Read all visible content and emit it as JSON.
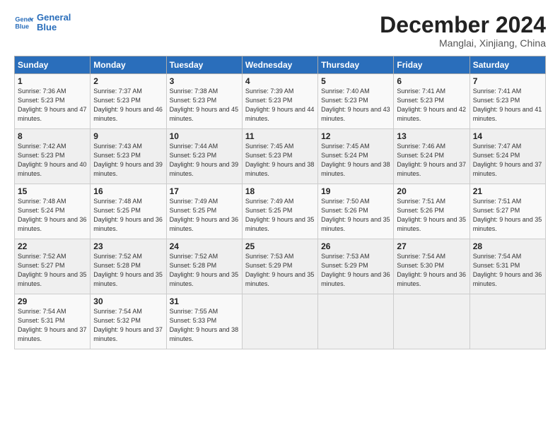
{
  "header": {
    "logo_line1": "General",
    "logo_line2": "Blue",
    "month": "December 2024",
    "location": "Manglai, Xinjiang, China"
  },
  "days_of_week": [
    "Sunday",
    "Monday",
    "Tuesday",
    "Wednesday",
    "Thursday",
    "Friday",
    "Saturday"
  ],
  "weeks": [
    [
      {
        "num": "1",
        "rise": "7:36 AM",
        "set": "5:23 PM",
        "daylight": "9 hours and 47 minutes."
      },
      {
        "num": "2",
        "rise": "7:37 AM",
        "set": "5:23 PM",
        "daylight": "9 hours and 46 minutes."
      },
      {
        "num": "3",
        "rise": "7:38 AM",
        "set": "5:23 PM",
        "daylight": "9 hours and 45 minutes."
      },
      {
        "num": "4",
        "rise": "7:39 AM",
        "set": "5:23 PM",
        "daylight": "9 hours and 44 minutes."
      },
      {
        "num": "5",
        "rise": "7:40 AM",
        "set": "5:23 PM",
        "daylight": "9 hours and 43 minutes."
      },
      {
        "num": "6",
        "rise": "7:41 AM",
        "set": "5:23 PM",
        "daylight": "9 hours and 42 minutes."
      },
      {
        "num": "7",
        "rise": "7:41 AM",
        "set": "5:23 PM",
        "daylight": "9 hours and 41 minutes."
      }
    ],
    [
      {
        "num": "8",
        "rise": "7:42 AM",
        "set": "5:23 PM",
        "daylight": "9 hours and 40 minutes."
      },
      {
        "num": "9",
        "rise": "7:43 AM",
        "set": "5:23 PM",
        "daylight": "9 hours and 39 minutes."
      },
      {
        "num": "10",
        "rise": "7:44 AM",
        "set": "5:23 PM",
        "daylight": "9 hours and 39 minutes."
      },
      {
        "num": "11",
        "rise": "7:45 AM",
        "set": "5:23 PM",
        "daylight": "9 hours and 38 minutes."
      },
      {
        "num": "12",
        "rise": "7:45 AM",
        "set": "5:24 PM",
        "daylight": "9 hours and 38 minutes."
      },
      {
        "num": "13",
        "rise": "7:46 AM",
        "set": "5:24 PM",
        "daylight": "9 hours and 37 minutes."
      },
      {
        "num": "14",
        "rise": "7:47 AM",
        "set": "5:24 PM",
        "daylight": "9 hours and 37 minutes."
      }
    ],
    [
      {
        "num": "15",
        "rise": "7:48 AM",
        "set": "5:24 PM",
        "daylight": "9 hours and 36 minutes."
      },
      {
        "num": "16",
        "rise": "7:48 AM",
        "set": "5:25 PM",
        "daylight": "9 hours and 36 minutes."
      },
      {
        "num": "17",
        "rise": "7:49 AM",
        "set": "5:25 PM",
        "daylight": "9 hours and 36 minutes."
      },
      {
        "num": "18",
        "rise": "7:49 AM",
        "set": "5:25 PM",
        "daylight": "9 hours and 35 minutes."
      },
      {
        "num": "19",
        "rise": "7:50 AM",
        "set": "5:26 PM",
        "daylight": "9 hours and 35 minutes."
      },
      {
        "num": "20",
        "rise": "7:51 AM",
        "set": "5:26 PM",
        "daylight": "9 hours and 35 minutes."
      },
      {
        "num": "21",
        "rise": "7:51 AM",
        "set": "5:27 PM",
        "daylight": "9 hours and 35 minutes."
      }
    ],
    [
      {
        "num": "22",
        "rise": "7:52 AM",
        "set": "5:27 PM",
        "daylight": "9 hours and 35 minutes."
      },
      {
        "num": "23",
        "rise": "7:52 AM",
        "set": "5:28 PM",
        "daylight": "9 hours and 35 minutes."
      },
      {
        "num": "24",
        "rise": "7:52 AM",
        "set": "5:28 PM",
        "daylight": "9 hours and 35 minutes."
      },
      {
        "num": "25",
        "rise": "7:53 AM",
        "set": "5:29 PM",
        "daylight": "9 hours and 35 minutes."
      },
      {
        "num": "26",
        "rise": "7:53 AM",
        "set": "5:29 PM",
        "daylight": "9 hours and 36 minutes."
      },
      {
        "num": "27",
        "rise": "7:54 AM",
        "set": "5:30 PM",
        "daylight": "9 hours and 36 minutes."
      },
      {
        "num": "28",
        "rise": "7:54 AM",
        "set": "5:31 PM",
        "daylight": "9 hours and 36 minutes."
      }
    ],
    [
      {
        "num": "29",
        "rise": "7:54 AM",
        "set": "5:31 PM",
        "daylight": "9 hours and 37 minutes."
      },
      {
        "num": "30",
        "rise": "7:54 AM",
        "set": "5:32 PM",
        "daylight": "9 hours and 37 minutes."
      },
      {
        "num": "31",
        "rise": "7:55 AM",
        "set": "5:33 PM",
        "daylight": "9 hours and 38 minutes."
      },
      null,
      null,
      null,
      null
    ]
  ]
}
